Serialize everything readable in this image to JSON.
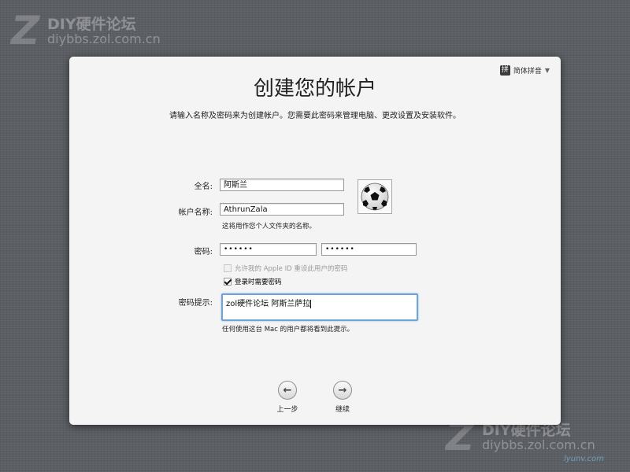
{
  "watermark": {
    "logo": "Z",
    "brand": "DIY硬件论坛",
    "url": "diybbs.zol.com.cn",
    "corner_mark": "lyunv.com"
  },
  "input_menu": {
    "flag": "拼",
    "label": "简体拼音",
    "arrow": "▼"
  },
  "dialog": {
    "title": "创建您的帐户",
    "subtitle": "请输入名称及密码来为创建帐户。您需要此密码来管理电脑、更改设置及安装软件。"
  },
  "form": {
    "full_name": {
      "label": "全名:",
      "value": "阿斯兰"
    },
    "account_name": {
      "label": "帐户名称:",
      "value": "AthrunZala",
      "hint": "这将用作您个人文件夹的名称。"
    },
    "password": {
      "label": "密码:",
      "value": "••••••",
      "verify_value": "••••••"
    },
    "allow_apple_id": {
      "label": "允许我的 Apple ID 重设此用户的密码",
      "checked": false,
      "enabled": false
    },
    "require_password": {
      "label": "登录时需要密码",
      "checked": true
    },
    "password_hint": {
      "label": "密码提示:",
      "value": "zol硬件论坛 阿斯兰萨拉",
      "note": "任何使用这台 Mac 的用户都将看到此提示。"
    }
  },
  "avatar": {
    "icon": "soccer-ball-icon"
  },
  "nav": {
    "back": {
      "icon": "arrow-left-icon",
      "glyph": "←",
      "label": "上一步"
    },
    "next": {
      "icon": "arrow-right-icon",
      "glyph": "→",
      "label": "继续"
    }
  }
}
